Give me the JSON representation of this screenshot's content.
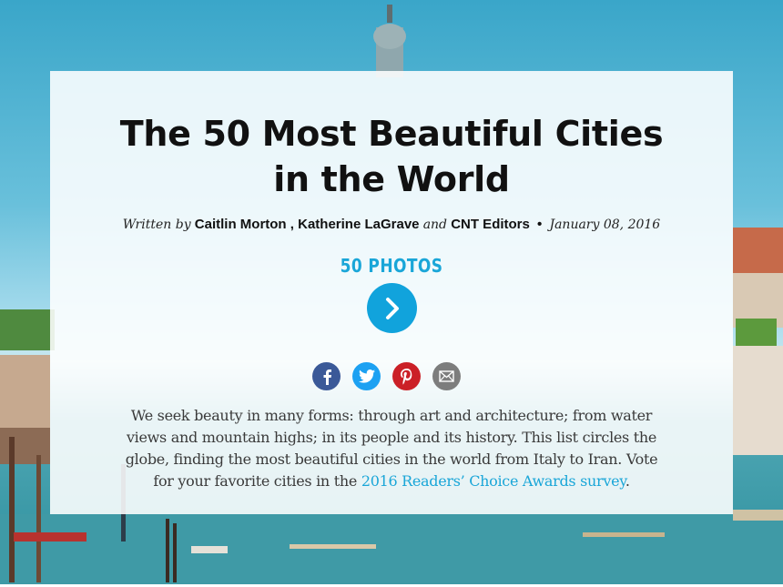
{
  "article": {
    "title": "The 50 Most Beautiful Cities in the World",
    "byline": {
      "written_by": "Written by",
      "author1": "Caitlin Morton",
      "comma": ",",
      "author2": "Katherine LaGrave",
      "and": "and",
      "author3": "CNT Editors",
      "bullet": "•",
      "date": "January 08, 2016"
    },
    "gallery": {
      "photos_label": "50 PHOTOS"
    },
    "share": {
      "items": [
        "facebook-icon",
        "twitter-icon",
        "pinterest-icon",
        "email-icon"
      ]
    },
    "intro": {
      "text": "We seek beauty in many forms: through art and architecture; from water views and mountain highs; in its people and its history. This list circles the globe, finding the most beautiful cities in the world from Italy to Iran. Vote for your favorite cities in the ",
      "link_text": "2016 Readers’ Choice Awards survey",
      "end": "."
    }
  },
  "colors": {
    "accent": "#1aa6d8",
    "facebook": "#3b5998",
    "twitter": "#1da1f2",
    "pinterest": "#cb2027",
    "email": "#7d7d7d"
  }
}
